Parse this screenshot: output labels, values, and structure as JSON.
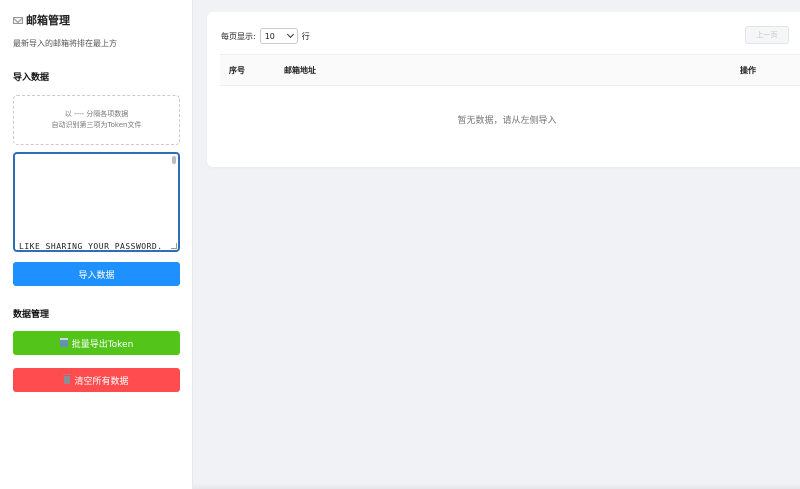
{
  "sidebar": {
    "title": "邮箱管理",
    "subtitle": "最新导入的邮箱将排在最上方",
    "import_section": "导入数据",
    "dropzone_line1": "以 ---- 分隔各项数据",
    "dropzone_line2": "自动识别第三项为Token文件",
    "textarea_value": "LIKE SHARING YOUR PASSWORD.",
    "import_button": "导入数据",
    "manage_section": "数据管理",
    "export_button": "批量导出Token",
    "clear_button": "清空所有数据"
  },
  "main": {
    "per_page_label": "每页显示:",
    "per_page_value": "10",
    "per_page_suffix": "行",
    "prev_button": "上一页",
    "columns": [
      "序号",
      "邮箱地址",
      "操作"
    ],
    "empty_message": "暂无数据，请从左侧导入"
  },
  "icons": {
    "title_icon": "mail-icon",
    "export_icon": "package-icon",
    "clear_icon": "trash-icon"
  },
  "colors": {
    "import_button": "#1e90ff",
    "export_button": "#52c41a",
    "clear_button": "#ff4d4f",
    "textarea_focus": "#2c6fb7"
  }
}
